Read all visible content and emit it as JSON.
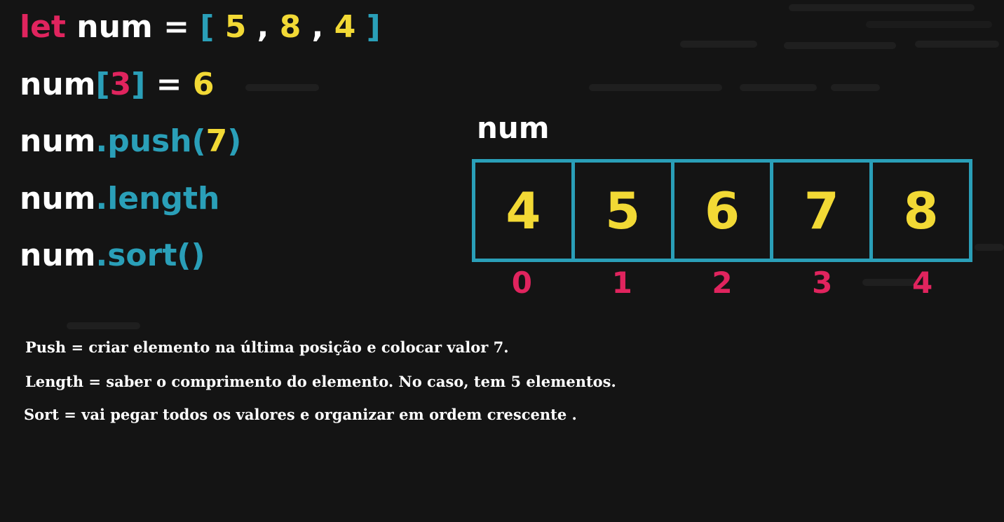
{
  "code": {
    "line1": {
      "kw": "let",
      "var": " num = ",
      "open": "[",
      "v1": " 5",
      "s1": " , ",
      "v2": "8",
      "s2": " , ",
      "v3": "4",
      "close": " ]"
    },
    "line2": {
      "var": "num",
      "open": "[",
      "idx": "3",
      "close": "]",
      "eq": " = ",
      "val": "6"
    },
    "line3": {
      "var": "num",
      "method": ".push(",
      "arg": "7",
      "close": ")"
    },
    "line4": {
      "var": "num",
      "method": ".length"
    },
    "line5": {
      "var": "num",
      "method": ".sort()"
    }
  },
  "array": {
    "name": "num",
    "values": [
      "4",
      "5",
      "6",
      "7",
      "8"
    ],
    "indices": [
      "0",
      "1",
      "2",
      "3",
      "4"
    ]
  },
  "notes": [
    "Push = criar elemento na última posição e colocar valor 7.",
    "Length = saber o comprimento do elemento. No caso, tem 5 elementos.",
    "Sort = vai pegar todos os valores e organizar em ordem crescente ."
  ],
  "colors": {
    "background": "#141414",
    "keyword": "#e0245e",
    "bracket_method": "#2a9fb8",
    "number": "#f2d935",
    "text": "#ffffff"
  }
}
